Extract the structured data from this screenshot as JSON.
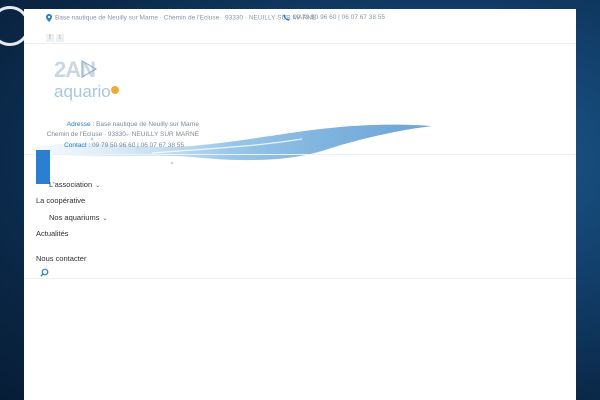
{
  "topbar": {
    "address": "Base nautique de Neuilly sur Marne · Chemin de l'Ecluse · 93330 · NEUILLY SUR MARNE",
    "phone": "09 79 50 96 60 | 06 07 67 38 55",
    "social": [
      "f",
      "t"
    ]
  },
  "logo": {
    "alt": "2AN aquario"
  },
  "header": {
    "address_label": "Adresse :",
    "address_line1": "Base nautique de Neuilly sur Marne",
    "address_line2": "Chemin de l'Ecluse · 93330 · NEUILLY SUR MARNE",
    "contact_label": "Contact :",
    "contact_value": "09 79 50 96 60 | 06 07 67 38 55"
  },
  "nav": {
    "items": [
      {
        "label": "L'association",
        "has_submenu": true
      },
      {
        "label": "La coopérative",
        "has_submenu": false
      },
      {
        "label": "Nos aquariums",
        "has_submenu": true
      },
      {
        "label": "Actualités",
        "has_submenu": false
      },
      {
        "label": "Nous contacter",
        "has_submenu": false
      }
    ],
    "submenu_glyph": "⌄"
  },
  "icons": {
    "pin": "map-pin-icon",
    "phone": "phone-icon",
    "search": "search-icon"
  },
  "colors": {
    "accent": "#1f7cc1",
    "tab": "#2a7fd0",
    "text": "#2b2f33",
    "muted": "#8a96a3"
  }
}
